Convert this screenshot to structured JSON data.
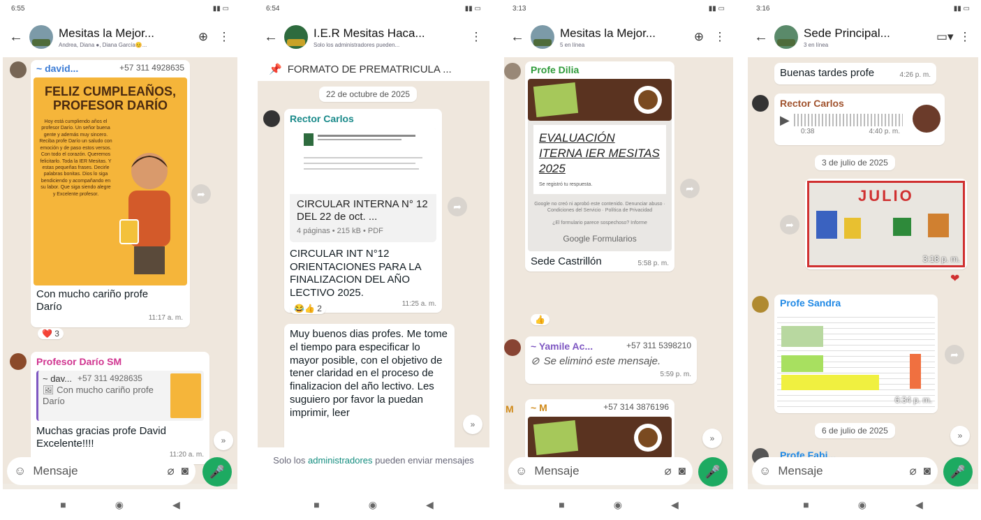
{
  "phones": [
    {
      "status_time": "6:55",
      "header": {
        "title": "Mesitas la Mejor...",
        "subtitle": "Andrea, Diana ●, Diana García😊..."
      },
      "messages": {
        "m1_sender": "~ david...",
        "m1_phone": "+57 311 4928635",
        "poster_title": "FELIZ CUMPLEAÑOS, PROFESOR DARÍO",
        "poster_body": "Hoy está cumpliendo años el profesor Darío. Un señor buena gente y además muy sincero. Reciba profe Darío un saludo con emoción y de paso estos versos. Con todo el corazón. Queremos felicitarlo. Toda la IER Mesitas. Y estas pequeñas frases. Decirle palabras bonitas. Dios lo siga bendiciendo y acompañando en su labor. Que siga siendo alegre y Excelente profesor.",
        "m1_caption": "Con mucho cariño profe Darío",
        "m1_time": "11:17 a. m.",
        "m1_reaction": "❤️ 3",
        "m2_sender": "Profesor Darío SM",
        "m2_quote_author": "~ dav...",
        "m2_quote_phone": "+57 311 4928635",
        "m2_quote_text": "🖼 Con mucho cariño profe Darío",
        "m2_text": "Muchas gracias profe David Excelente!!!!",
        "m2_time": "11:20 a. m."
      },
      "composer_placeholder": "Mensaje"
    },
    {
      "status_time": "6:54",
      "header": {
        "title": "I.E.R Mesitas Haca...",
        "subtitle": "Solo los administradores pueden..."
      },
      "pinned": "FORMATO DE PREMATRICULA ...",
      "date": "22 de octubre de 2025",
      "messages": {
        "sender": "Rector Carlos",
        "doc_name": "CIRCULAR INTERNA N° 12  DEL 22 de oct. ...",
        "doc_meta": "4 páginas • 215 kB • PDF",
        "caption": "CIRCULAR INT N°12 ORIENTACIONES PARA LA FINALIZACION DEL AÑO LECTIVO 2025.",
        "caption_time": "11:25 a. m.",
        "reaction": "😂👍 2",
        "text2": "Muy buenos dias profes. Me tome el tiempo para especificar lo mayor posible, con el objetivo de tener claridad en el proceso de finalizacion del año lectivo. Les suguiero por favor la puedan imprimir, leer"
      },
      "admin_note_pre": "Solo los ",
      "admin_note_link": "administradores",
      "admin_note_post": " pueden enviar mensajes"
    },
    {
      "status_time": "3:13",
      "header": {
        "title": "Mesitas la Mejor...",
        "subtitle": "5 en línea"
      },
      "messages": {
        "sender1": "Profe Dilia",
        "form_title": "EVALUACIÓN ITERNA IER MESITAS 2025",
        "form_small": "Se registró tu respuesta.",
        "form_footer": "Google no creó ni aprobó este contenido. Denunciar abuso · Condiciones del Servicio · Política de Privacidad",
        "form_footer2": "¿El formulario parece sospechoso? Informe",
        "gforms": "Google Formularios",
        "caption1": "Sede Castrillón",
        "time1": "5:58 p. m.",
        "reaction1": "👍",
        "sender2": "~ Yamile Ac...",
        "phone2": "+57 311 5398210",
        "deleted": "Se eliminó este mensaje.",
        "time2": "5:59 p. m.",
        "sender3": "~ M",
        "phone3": "+57 314 3876196"
      },
      "composer_placeholder": "Mensaje"
    },
    {
      "status_time": "3:16",
      "header": {
        "title": "Sede Principal...",
        "subtitle": "3 en línea"
      },
      "messages": {
        "text1": "Buenas tardes profe",
        "time1": "4:26 p. m.",
        "sender2": "Rector Carlos",
        "audio_dur": "0:38",
        "audio_time": "4:40 p. m.",
        "date1": "3 de julio de 2025",
        "cal_text": "JULIO",
        "img_time": "3:18 p. m.",
        "sender3": "Profe Sandra",
        "sheet_time": "6:34 p. m.",
        "date2": "6 de julio de 2025",
        "sender4": "Profe Fabi..."
      },
      "composer_placeholder": "Mensaje"
    }
  ],
  "colors": {
    "chat_bg": "#efe7dd",
    "accent_green": "#1daa61",
    "link_teal": "#128c7e"
  }
}
